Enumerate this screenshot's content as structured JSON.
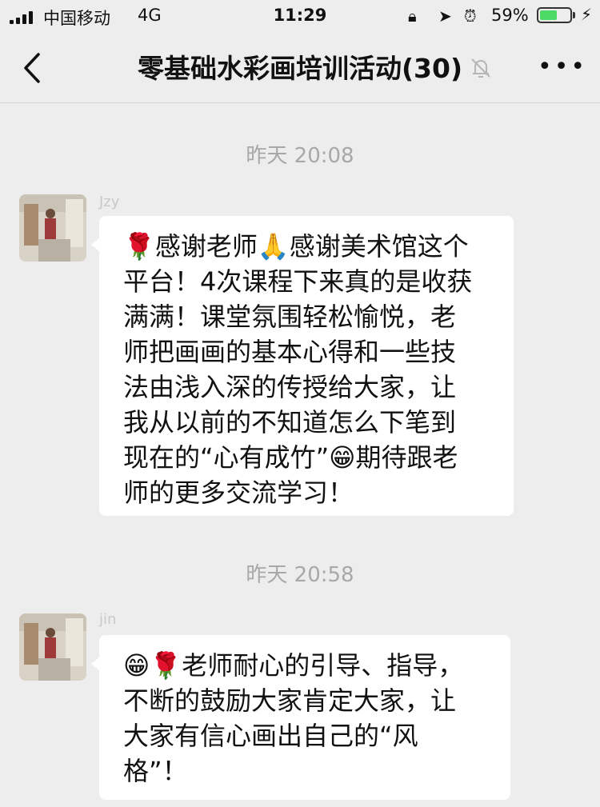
{
  "status_bar": {
    "carrier": "中国移动",
    "network": "4G",
    "time": "11:29",
    "battery_percent": "59%",
    "battery_level": 0.59,
    "icons": [
      "signal-icon",
      "rotation-lock-icon",
      "location-arrow-icon",
      "alarm-icon",
      "battery-icon",
      "charging-icon"
    ]
  },
  "nav": {
    "title": "零基础水彩画培训活动(30)",
    "back_icon": "chevron-left-icon",
    "mute_icon": "bell-slash-icon",
    "more_label": "•••"
  },
  "messages": [
    {
      "timestamp": "昨天 20:08",
      "sender": "Jzy",
      "lines": [
        "🌹感谢老师🙏感谢美术馆这个",
        "平台！4次课程下来真的是收获",
        "满满！课堂氛围轻松愉悦，老",
        "师把画画的基本心得和一些技",
        "法由浅入深的传授给大家，让",
        "我从以前的不知道怎么下笔到",
        "现在的“心有成竹”😁期待跟老",
        "师的更多交流学习！"
      ]
    },
    {
      "timestamp": "昨天 20:58",
      "sender": "jin",
      "lines": [
        "😁🌹老师耐心的引导、指导，",
        "不断的鼓励大家肯定大家，让",
        "大家有信心画出自己的“风",
        "格”！"
      ]
    }
  ],
  "colors": {
    "background": "#ededed",
    "bubble": "#ffffff",
    "timestamp": "#a8a8a8",
    "battery": "#4cd964"
  }
}
